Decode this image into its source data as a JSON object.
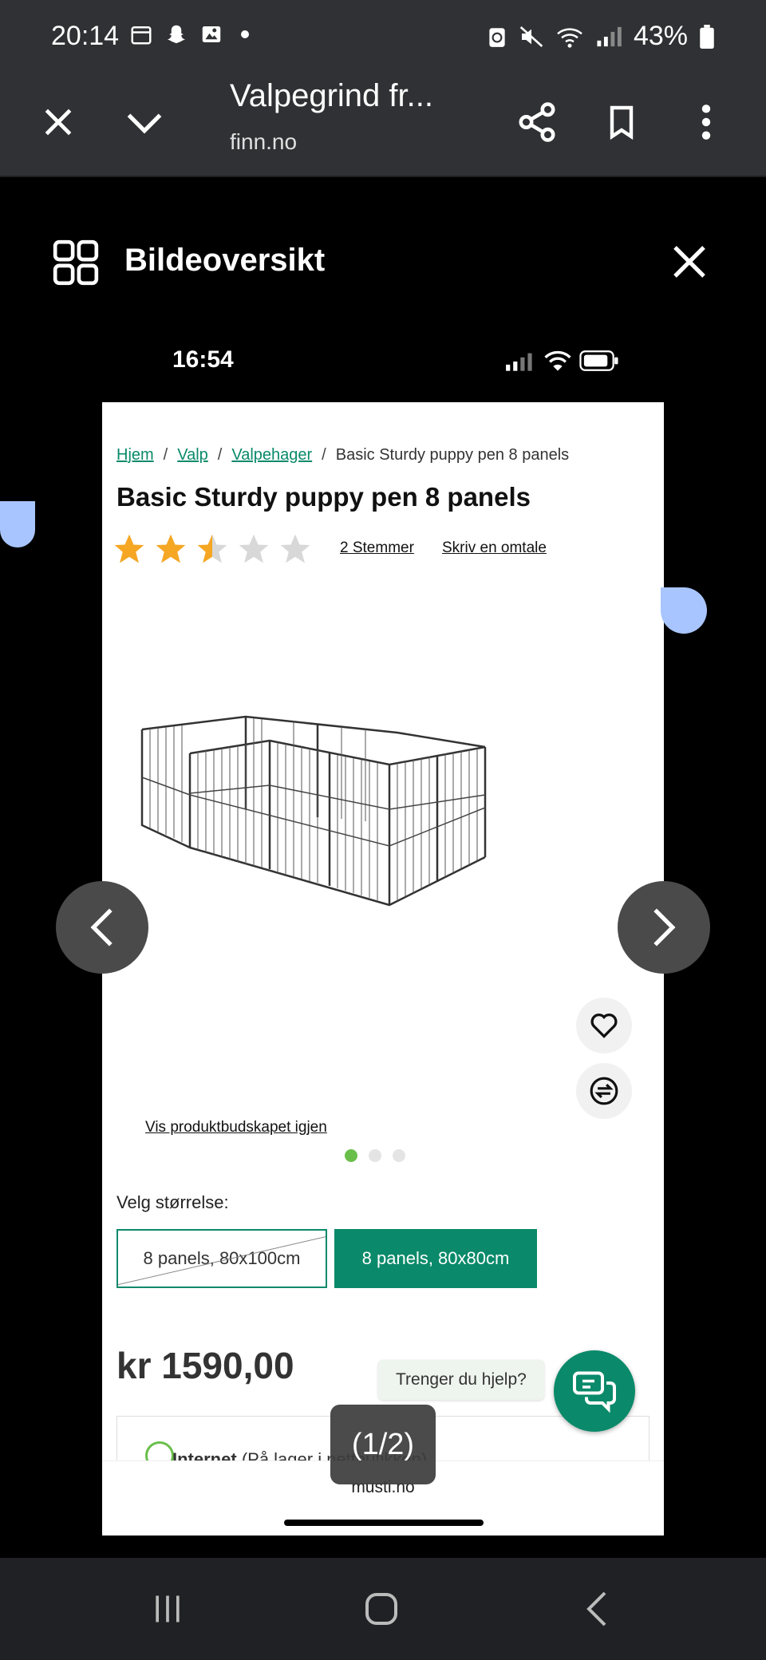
{
  "status_bar": {
    "time": "20:14",
    "battery": "43%"
  },
  "browser": {
    "title": "Valpegrind fr...",
    "url": "finn.no"
  },
  "gallery": {
    "title": "Bildeoversikt",
    "counter": "(1/2)"
  },
  "embedded_status": {
    "time": "16:54"
  },
  "page": {
    "breadcrumbs": [
      "Hjem",
      "Valp",
      "Valpehager",
      "Basic Sturdy puppy pen 8 panels"
    ],
    "separator": "/",
    "product_title": "Basic Sturdy puppy pen 8 panels",
    "rating": 2.5,
    "rating_max": 5,
    "votes_link": "2 Stemmer",
    "review_link": "Skriv en omtale",
    "show_offer_link": "Vis produktbudskapet igjen",
    "image_dots": 3,
    "active_dot": 1,
    "size_label": "Velg størrelse:",
    "size_options": [
      "8 panels, 80x100cm",
      "8 panels, 80x80cm"
    ],
    "selected_size": "8 panels, 80x80cm",
    "price": "kr 1590,00",
    "help_text": "Trenger du hjelp?",
    "availability_bold": "Internet",
    "availability_rest": "(På lager i nettbutikken)",
    "bottom_url": "musti.no"
  },
  "colors": {
    "accent": "#0a8a6a",
    "star": "#f5a623",
    "dot_active": "#6abf4b"
  }
}
